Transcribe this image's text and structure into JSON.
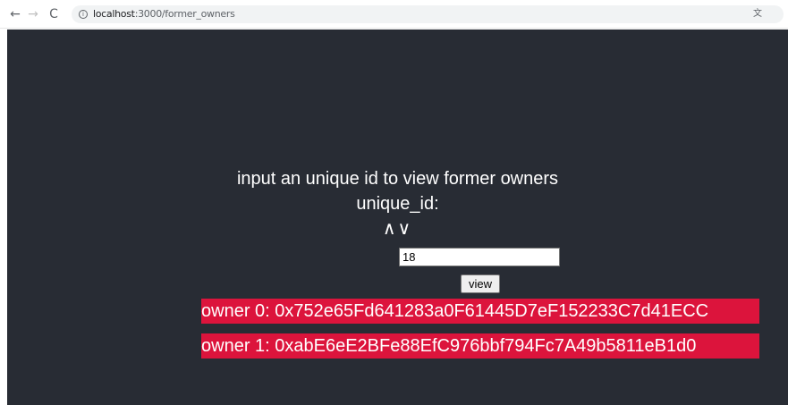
{
  "browser": {
    "url_host": "localhost",
    "url_path": ":3000/former_owners",
    "icons": [
      "back-arrow-icon",
      "forward-arrow-icon",
      "reload-icon",
      "info-icon",
      "translate-icon"
    ]
  },
  "page": {
    "title": "input an unique id to view former owners",
    "id_label": "unique_id:",
    "sort_arrows": "∧∨",
    "input_value": "18",
    "view_button_label": "view",
    "owners": [
      "owner 0: 0x752e65Fd641283a0F61445D7eF152233C7d41ECC",
      "owner 1: 0xabE6eE2BFe88EfC976bbf794Fc7A49b5811eB1d0"
    ]
  },
  "colors": {
    "background": "#282c34",
    "owner_highlight": "#dc143c",
    "text": "#ffffff"
  }
}
